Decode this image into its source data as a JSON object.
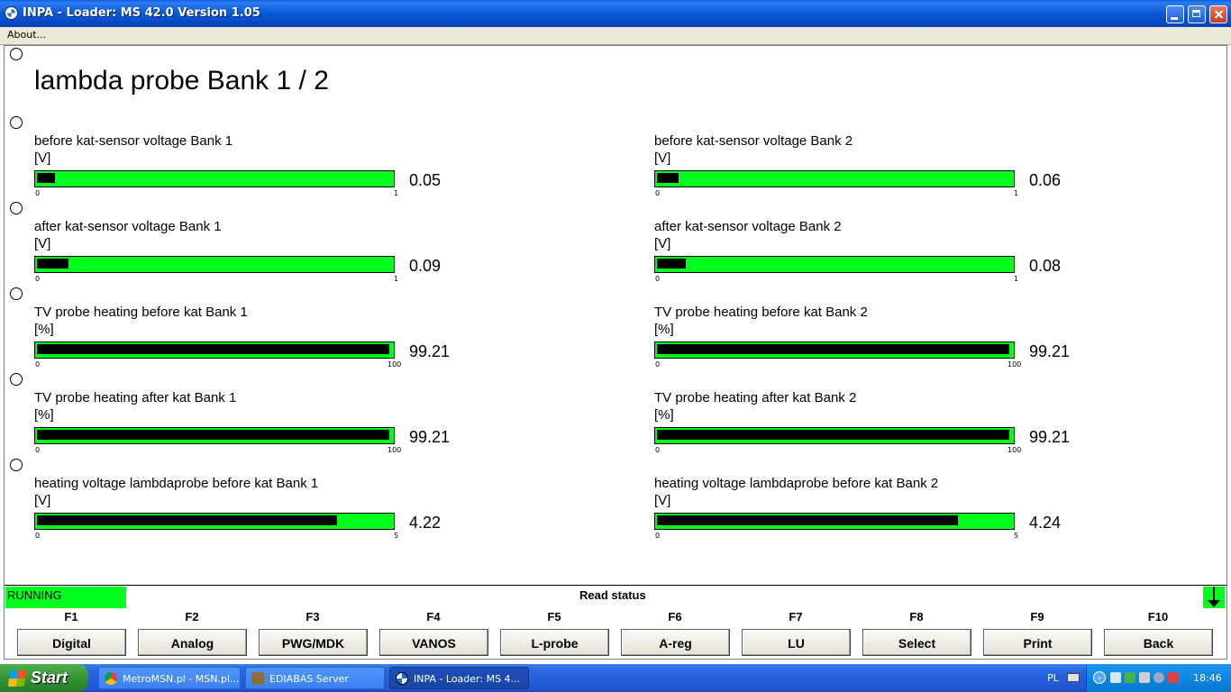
{
  "window": {
    "title": "INPA - Loader:  MS 42.0 Version 1.05"
  },
  "menu": {
    "about": "About..."
  },
  "page_title": "lambda probe Bank 1 / 2",
  "meters": [
    {
      "label": "before kat-sensor voltage Bank 1",
      "unit": "[V]",
      "min": "0",
      "max": "1",
      "value": "0.05",
      "fill": 0.05
    },
    {
      "label": "before kat-sensor voltage Bank 2",
      "unit": "[V]",
      "min": "0",
      "max": "1",
      "value": "0.06",
      "fill": 0.06
    },
    {
      "label": "after kat-sensor voltage Bank 1",
      "unit": "[V]",
      "min": "0",
      "max": "1",
      "value": "0.09",
      "fill": 0.09
    },
    {
      "label": "after kat-sensor voltage Bank 2",
      "unit": "[V]",
      "min": "0",
      "max": "1",
      "value": "0.08",
      "fill": 0.08
    },
    {
      "label": "TV probe heating before kat Bank 1",
      "unit": "[%]",
      "min": "0",
      "max": "100",
      "value": "99.21",
      "fill": 0.9921
    },
    {
      "label": "TV probe heating before kat Bank 2",
      "unit": "[%]",
      "min": "0",
      "max": "100",
      "value": "99.21",
      "fill": 0.9921
    },
    {
      "label": "TV probe heating after kat Bank 1",
      "unit": "[%]",
      "min": "0",
      "max": "100",
      "value": "99.21",
      "fill": 0.9921
    },
    {
      "label": "TV probe heating after kat Bank 2",
      "unit": "[%]",
      "min": "0",
      "max": "100",
      "value": "99.21",
      "fill": 0.9921
    },
    {
      "label": "heating voltage lambdaprobe before kat Bank 1",
      "unit": "[V]",
      "min": "0",
      "max": "5",
      "value": "4.22",
      "fill": 0.844
    },
    {
      "label": "heating voltage lambdaprobe before kat Bank 2",
      "unit": "[V]",
      "min": "0",
      "max": "5",
      "value": "4.24",
      "fill": 0.848
    }
  ],
  "status": {
    "running": "RUNNING",
    "read": "Read status"
  },
  "fkeys": [
    {
      "key": "F1",
      "label": "Digital"
    },
    {
      "key": "F2",
      "label": "Analog"
    },
    {
      "key": "F3",
      "label": "PWG/MDK"
    },
    {
      "key": "F4",
      "label": "VANOS"
    },
    {
      "key": "F5",
      "label": "L-probe"
    },
    {
      "key": "F6",
      "label": "A-reg"
    },
    {
      "key": "F7",
      "label": "LU"
    },
    {
      "key": "F8",
      "label": "Select"
    },
    {
      "key": "F9",
      "label": "Print"
    },
    {
      "key": "F10",
      "label": "Back"
    }
  ],
  "taskbar": {
    "start": "Start",
    "tasks": [
      {
        "label": "MetroMSN.pl - MSN.pl...",
        "icon": "chrome-icon"
      },
      {
        "label": "EDIABAS Server",
        "icon": "ediabas-icon"
      },
      {
        "label": "INPA - Loader:  MS 4...",
        "icon": "inpa-icon"
      }
    ],
    "lang": "PL",
    "clock": "18:46"
  },
  "colors": {
    "bar_green": "#00ff1e",
    "bar_fill": "#000000",
    "titlebar_blue": "#0a58d6"
  }
}
